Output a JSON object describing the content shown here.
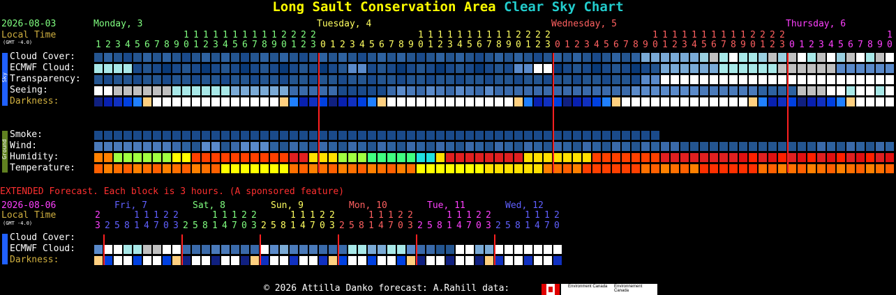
{
  "title": {
    "location": "Long Sault Conservation Area",
    "suffix": "Clear Sky Chart"
  },
  "header": {
    "date": "2026-08-03",
    "local_time": "Local Time",
    "gmt": "(GMT -4.0)",
    "days": [
      {
        "label": "Monday, 3",
        "color": "#80ff80"
      },
      {
        "label": "Tuesday, 4",
        "color": "#ffff60"
      },
      {
        "label": "Wednesday, 5",
        "color": "#ff6060"
      },
      {
        "label": "Thursday, 6",
        "color": "#ff40ff"
      }
    ],
    "hours_tens": "1111111111112222        1111111111112222        1111111111112222        11111111112",
    "hours_ones": "123456789012301234567890123456789012301234567890123456789012301234567890123456789012345678900"
  },
  "sky_label": "Sky",
  "ground_label": "Ground",
  "rows": {
    "cloud": "Cloud Cover:",
    "ecmwf": "ECMWF Cloud:",
    "transparency": "Transparency:",
    "seeing": "Seeing:",
    "darkness": "Darkness:",
    "smoke": "Smoke:",
    "wind": "Wind:",
    "humidity": "Humidity:",
    "temperature": "Temperature:"
  },
  "extended": {
    "note": "EXTENDED Forecast. Each block is 3 hours. (A sponsored feature)",
    "date": "2026-08-06",
    "local_time": "Local Time",
    "gmt": "(GMT -4.0)",
    "days": [
      {
        "label": "Fri, 7",
        "color": "#6060ff"
      },
      {
        "label": "Sat, 8",
        "color": "#80ff80"
      },
      {
        "label": "Sun, 9",
        "color": "#ffff60"
      },
      {
        "label": "Mon, 10",
        "color": "#ff6060"
      },
      {
        "label": "Tue, 11",
        "color": "#ff40ff"
      },
      {
        "label": "Wed, 12",
        "color": "#6060ff"
      }
    ],
    "tens_row": "2   11122   11122   11122   11122   11122   1112",
    "ones_row": "325814703258147032581470325814703258147032581470",
    "cloud": "Cloud Cover:",
    "ecmwf": "ECMWF Cloud:",
    "darkness": "Darkness:"
  },
  "footer": {
    "text": "© 2026 Attilla Danko  forecast: A.Rahill  data:",
    "env1": "Environment Canada",
    "env2": "Environnement Canada"
  },
  "chart_data": {
    "type": "heatmap",
    "title": "Long Sault Conservation Area Clear Sky Chart",
    "hours_start": 1,
    "midnight_markers": [
      "Tuesday, 4",
      "Wednesday, 5",
      "Thursday, 6"
    ],
    "cloud_cover_levels": "0=overcast(dark blue) .. 10=clear(white)",
    "palette": {
      "overcast": "#0a3a78",
      "cloud90": "#1a4a8a",
      "cloud80": "#2a5a9a",
      "cloud70": "#3a6aaa",
      "cloud60": "#4a7aba",
      "cloud50": "#5a8aca",
      "cloud40": "#7aaad6",
      "cloud30": "#9acfe0",
      "cloud20": "#a8e8e8",
      "cloud10": "#c0c0c0",
      "clear": "#ffffff"
    }
  }
}
